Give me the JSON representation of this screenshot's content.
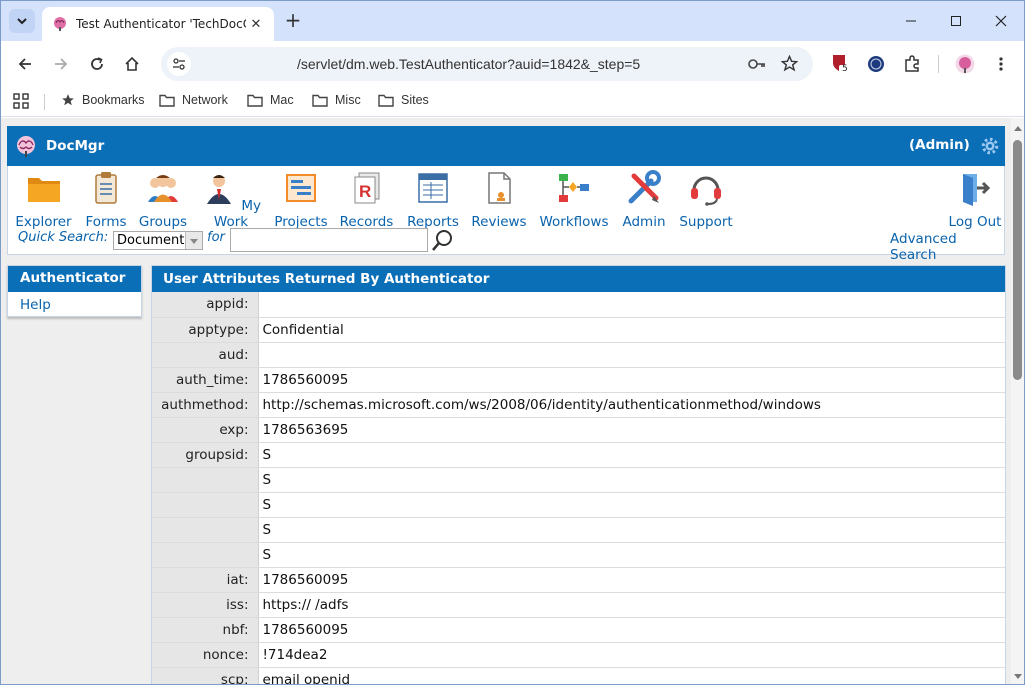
{
  "browser": {
    "tab_title": "Test Authenticator 'TechDocOID",
    "url": "/servlet/dm.web.TestAuthenticator?auid=1842&_step=5",
    "ext_badge": "5",
    "bookmarks": [
      "Bookmarks",
      "Network",
      "Mac",
      "Misc",
      "Sites"
    ]
  },
  "header": {
    "app_name": "DocMgr",
    "user": "(Admin)"
  },
  "menu": [
    {
      "label": "Explorer",
      "icon": "folder-icon"
    },
    {
      "label": "Forms",
      "icon": "clipboard-icon"
    },
    {
      "label": "Groups",
      "icon": "group-icon"
    },
    {
      "label": "My Work",
      "icon": "person-icon"
    },
    {
      "label": "Projects",
      "icon": "projects-icon"
    },
    {
      "label": "Records",
      "icon": "records-icon"
    },
    {
      "label": "Reports",
      "icon": "reports-icon"
    },
    {
      "label": "Reviews",
      "icon": "reviews-icon"
    },
    {
      "label": "Workflows",
      "icon": "workflow-icon"
    },
    {
      "label": "Admin",
      "icon": "tools-icon"
    },
    {
      "label": "Support",
      "icon": "headset-icon"
    }
  ],
  "logout": "Log Out",
  "quick_search": {
    "label": "Quick Search:",
    "type": "Document",
    "for_label": "for",
    "value": "",
    "advanced": "Advanced Search"
  },
  "sidebar": {
    "title": "Authenticator",
    "items": [
      "Help"
    ]
  },
  "panel": {
    "title": "User Attributes Returned By Authenticator",
    "rows": [
      {
        "k": "appid:",
        "v": ""
      },
      {
        "k": "apptype:",
        "v": "Confidential"
      },
      {
        "k": "aud:",
        "v": ""
      },
      {
        "k": "auth_time:",
        "v": "1786560095"
      },
      {
        "k": "authmethod:",
        "v": "http://schemas.microsoft.com/ws/2008/06/identity/authenticationmethod/windows"
      },
      {
        "k": "exp:",
        "v": "1786563695"
      },
      {
        "k": "groupsid:",
        "v": "S"
      },
      {
        "k": "",
        "v": "S"
      },
      {
        "k": "",
        "v": "S"
      },
      {
        "k": "",
        "v": "S"
      },
      {
        "k": "",
        "v": "S"
      },
      {
        "k": "iat:",
        "v": "1786560095"
      },
      {
        "k": "iss:",
        "v": "https://                /adfs"
      },
      {
        "k": "nbf:",
        "v": "1786560095"
      },
      {
        "k": "nonce:",
        "v": "!714dea2"
      },
      {
        "k": "scp:",
        "v": "email openid"
      }
    ]
  },
  "colors": {
    "brand": "#0b6fb8",
    "link": "#0a63ad",
    "tabbar": "#d4e2fc"
  }
}
